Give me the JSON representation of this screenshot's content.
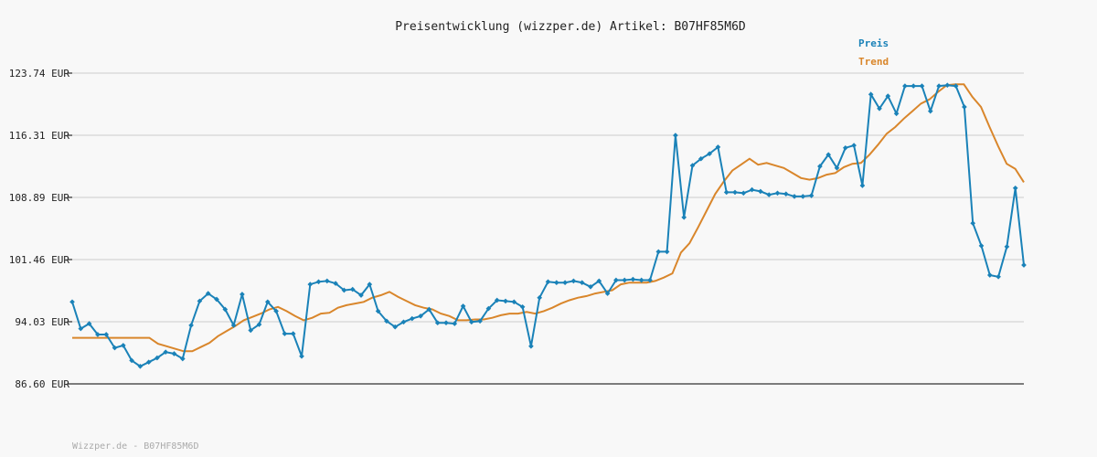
{
  "chart_data": {
    "type": "line",
    "title": "Preisentwicklung (wizzper.de) Artikel: B07HF85M6D",
    "footer": "Wizzper.de - B07HF85M6D",
    "ylim": [
      86.6,
      123.74
    ],
    "yticks": [
      "86.60 EUR",
      "94.03 EUR",
      "101.46 EUR",
      "108.89 EUR",
      "116.31 EUR",
      "123.74 EUR"
    ],
    "ytick_values": [
      86.6,
      94.03,
      101.46,
      108.89,
      116.31,
      123.74
    ],
    "grid": true,
    "legend": "top-right",
    "series": [
      {
        "name": "Preis",
        "color": "#1a82b8",
        "values": [
          96.4,
          93.2,
          93.8,
          92.5,
          92.5,
          90.9,
          91.2,
          89.4,
          88.7,
          89.2,
          89.7,
          90.4,
          90.2,
          89.6,
          93.6,
          96.5,
          97.4,
          96.7,
          95.5,
          93.6,
          97.3,
          93.0,
          93.7,
          96.4,
          95.3,
          92.6,
          92.6,
          89.9,
          98.5,
          98.8,
          98.9,
          98.6,
          97.8,
          97.9,
          97.2,
          98.5,
          95.3,
          94.1,
          93.4,
          94.0,
          94.4,
          94.7,
          95.5,
          93.9,
          93.9,
          93.8,
          95.9,
          94.0,
          94.1,
          95.6,
          96.6,
          96.5,
          96.4,
          95.8,
          91.1,
          96.9,
          98.8,
          98.7,
          98.7,
          98.9,
          98.7,
          98.2,
          98.9,
          97.4,
          99.0,
          99.0,
          99.1,
          99.0,
          99.0,
          102.4,
          102.4,
          116.3,
          106.5,
          112.7,
          113.5,
          114.1,
          114.9,
          109.5,
          109.5,
          109.4,
          109.8,
          109.6,
          109.2,
          109.4,
          109.3,
          109.0,
          109.0,
          109.1,
          112.6,
          114.0,
          112.4,
          114.8,
          115.1,
          110.3,
          121.2,
          119.5,
          121.0,
          118.9,
          122.2,
          122.2,
          122.2,
          119.2,
          122.2,
          122.3,
          122.2,
          119.7,
          105.8,
          103.1,
          99.6,
          99.4,
          103.0,
          110.0,
          100.8
        ]
      },
      {
        "name": "Trend",
        "color": "#d9862b",
        "values": [
          92.1,
          92.1,
          92.1,
          92.1,
          92.1,
          92.1,
          92.1,
          92.1,
          92.1,
          92.1,
          91.4,
          91.1,
          90.8,
          90.5,
          90.5,
          91.0,
          91.5,
          92.3,
          92.9,
          93.5,
          94.2,
          94.6,
          95.0,
          95.5,
          95.8,
          95.3,
          94.7,
          94.2,
          94.5,
          95.0,
          95.1,
          95.7,
          96.0,
          96.2,
          96.4,
          96.9,
          97.2,
          97.6,
          97.0,
          96.5,
          96.0,
          95.7,
          95.5,
          95.0,
          94.7,
          94.2,
          94.2,
          94.3,
          94.3,
          94.5,
          94.8,
          95.0,
          95.0,
          95.2,
          95.0,
          95.3,
          95.7,
          96.2,
          96.6,
          96.9,
          97.1,
          97.4,
          97.6,
          97.8,
          98.5,
          98.7,
          98.7,
          98.7,
          98.9,
          99.3,
          99.8,
          102.3,
          103.4,
          105.3,
          107.3,
          109.3,
          110.8,
          112.1,
          112.8,
          113.5,
          112.8,
          113.0,
          112.7,
          112.4,
          111.8,
          111.2,
          111.0,
          111.2,
          111.6,
          111.8,
          112.5,
          112.9,
          113.0,
          114.0,
          115.2,
          116.5,
          117.3,
          118.3,
          119.2,
          120.1,
          120.6,
          121.5,
          122.3,
          122.4,
          122.4,
          120.9,
          119.7,
          117.3,
          115.0,
          112.9,
          112.3,
          110.7
        ]
      }
    ]
  }
}
